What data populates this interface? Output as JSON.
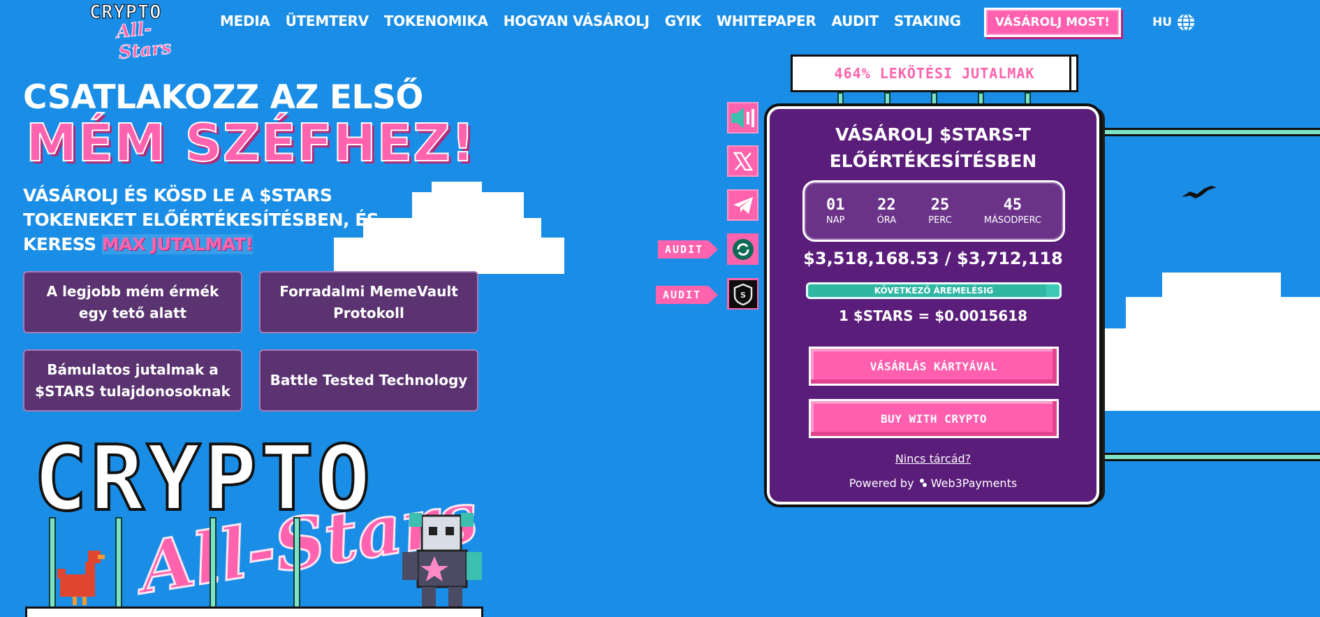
{
  "logo": {
    "line1": "CRYPTO",
    "line2": "All-Stars"
  },
  "nav": {
    "items": [
      "MEDIA",
      "ÜTEMTERV",
      "TOKENOMIKA",
      "HOGYAN VÁSÁROLJ",
      "GYIK",
      "WHITEPAPER",
      "AUDIT",
      "STAKING"
    ],
    "buy_now": "VÁSÁROLJ MOST!",
    "lang": "HU"
  },
  "hero": {
    "title_line1": "CSATLAKOZZ AZ ELSŐ",
    "title_line2": "MÉM SZÉFHEZ!",
    "sub_line1": "VÁSÁROLJ ÉS KÖSD LE A $STARS",
    "sub_line2": "TOKENEKET ELŐÉRTÉKESÍTÉSBEN, ÉS",
    "sub_line3": "KERESS",
    "sub_highlight": "MAX JUTALMAT!",
    "features": [
      "A legjobb mém érmék egy tető alatt",
      "Forradalmi MemeVault Protokoll",
      "Bámulatos jutalmak a $STARS tulajdonosoknak",
      "Battle Tested Technology"
    ]
  },
  "big_logo": {
    "letters": "CRYPTO",
    "script": "All-Stars"
  },
  "social": {
    "icons": [
      "speaker-icon",
      "x-icon",
      "telegram-icon"
    ]
  },
  "audit": {
    "label": "AUDIT"
  },
  "presale": {
    "banner": "464% LEKÖTÉSI JUTALMAK",
    "title_line1": "VÁSÁROLJ $STARS-T",
    "title_line2": "ELŐÉRTÉKESÍTÉSBEN",
    "countdown": [
      {
        "value": "01",
        "label": "NAP"
      },
      {
        "value": "22",
        "label": "ÓRA"
      },
      {
        "value": "25",
        "label": "PERC"
      },
      {
        "value": "45",
        "label": "MÁSODPERC"
      }
    ],
    "raised": "$3,518,168.53 / $3,712,118",
    "progress_label": "KÖVETKEZŐ ÁREMELÉSIG",
    "progress_fraction": 0.948,
    "rate": "1 $STARS = $0.0015618",
    "card_button": "VÁSÁRLÁS KÁRTYÁVAL",
    "crypto_button": "BUY WITH CRYPTO",
    "no_wallet": "Nincs tárcád?",
    "powered_by": "Powered by",
    "powered_brand": "Web3Payments"
  },
  "colors": {
    "background": "#1a8ee6",
    "accent_pink": "#ff63ad",
    "panel_purple": "#5a1d7a",
    "mint": "#7ee3c6"
  }
}
